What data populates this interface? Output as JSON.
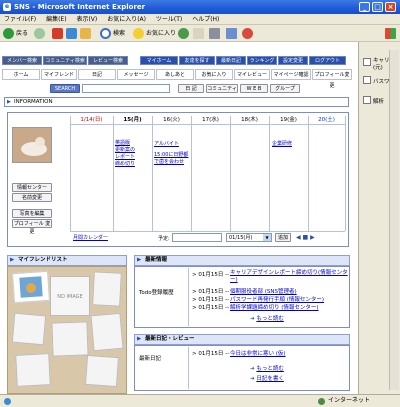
{
  "window": {
    "title": "SNS - Microsoft Internet Explorer",
    "icon": "ie-icon"
  },
  "menu": [
    "ファイル(F)",
    "編集(E)",
    "表示(V)",
    "お気に入り(A)",
    "ツール(T)",
    "ヘルプ(H)"
  ],
  "toolbar": {
    "back": "戻る",
    "search": "検索",
    "favorites": "お気に入り"
  },
  "sidepane": {
    "item1": "キャリア",
    "item1b": "(元)",
    "item2": "バスワ",
    "item3": "解析"
  },
  "nav_top": [
    "メンバー検索",
    "コミュニティ検索",
    "レビュー検索",
    "マイホーム",
    "友達を探す",
    "最新日記",
    "ランキング",
    "設定変更",
    "ログアウト"
  ],
  "nav_sub": [
    "ホーム",
    "マイフレンド",
    "日記",
    "メッセージ",
    "あしあと",
    "お気に入り",
    "マイレビュー",
    "マイページ確認",
    "プロフィール変更"
  ],
  "search_row": {
    "search_btn": "SEARCH",
    "diary_btn": "日 記",
    "community_btn": "コミュニティ",
    "web_btn": "W E B",
    "group_btn": "グループ"
  },
  "info": {
    "label": "INFORMATION"
  },
  "calendar": {
    "days": [
      "1/14(日)",
      "15(月)",
      "16(火)",
      "17(水)",
      "18(木)",
      "19(金)",
      "20(土)"
    ],
    "events": {
      "mon": "当日中に新規登録者の確認(送信)",
      "mon_display": "英語版\n更新案の\nレポート\n締め切り",
      "tue1": "アルバイト",
      "tue2": "15:00に日野都で歯を会わせ",
      "fri": "企業研修"
    },
    "footer_link": "月間カレンダー",
    "yotei_label": "予定:",
    "date_select": "01/15(月)",
    "add_btn": "追加",
    "nav_arrows": "◀ ■ ▶"
  },
  "profile": {
    "btn1": "情報センター",
    "btn2": "名前変更",
    "btn3": "写真を編集",
    "btn4": "プロフィール 変更"
  },
  "myfriend": {
    "title": "マイフレンドリスト",
    "no_image": "NO IMAGE"
  },
  "latest_info": {
    "title": "最新情報",
    "label": "Todo登録履歴",
    "items": [
      {
        "date": "> 01月15日 --",
        "text": "キャリアデザインレポート締め切り(情報センター)"
      },
      {
        "date": "> 01月15日 --",
        "text": "個期服役者部 (SNS管理者)"
      },
      {
        "date": "> 01月15日 --",
        "text": "パスワード再発行手順 (情報センター)"
      },
      {
        "date": "> 01月15日 --",
        "text": "解析学課題締め切り (情報センター)"
      }
    ],
    "more": "もっと読む"
  },
  "latest_diary": {
    "title": "最新日記・レビュー",
    "label": "最新日記",
    "items": [
      {
        "date": "> 01月15日 --",
        "text": "今日は非常に寒い (仮)"
      }
    ],
    "more": "もっと読む",
    "write": "日記を書く"
  },
  "status": {
    "zone": "インターネット"
  }
}
